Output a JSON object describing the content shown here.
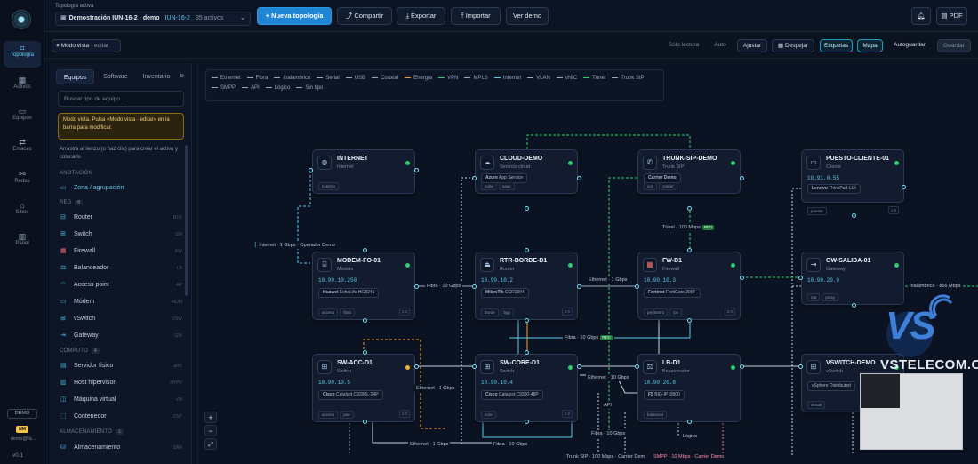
{
  "rail": {
    "items": [
      {
        "label": "Topología"
      },
      {
        "label": "Activos"
      },
      {
        "label": "Equipos"
      },
      {
        "label": "Enlaces"
      },
      {
        "label": "Redes"
      },
      {
        "label": "Sitios"
      },
      {
        "label": "Panel"
      }
    ],
    "badge": "DEMO",
    "avatar": "NM",
    "email": "demo@fa...",
    "version": "v0.1"
  },
  "topbar": {
    "breadcrumb": "Topología activa",
    "project": "Demostración IUN-16-2 · demo",
    "project_code": "IUN-16-2",
    "project_count": "35 activos",
    "btn_new": "+ Nueva topología",
    "btn_share": "Compartir",
    "btn_export": "Exportar",
    "btn_import": "Importar",
    "btn_demo": "Ver demo",
    "btn_pdf": "PDF"
  },
  "subbar": {
    "mode": "Modo vista",
    "mode_action": "· editar",
    "readonly": "Sólo lectura",
    "auto": "Auto",
    "fit": "Ajustar",
    "clear": "Despejar",
    "labels": "Etiquetas",
    "map": "Mapa",
    "autosave": "Autoguardar",
    "save": "Guardar"
  },
  "panel": {
    "tabs": [
      "Equipos",
      "Software",
      "Inventario",
      "Bi"
    ],
    "search_placeholder": "Buscar tipo de equipo...",
    "notice": "Modo vista. Pulsa «Modo vista · editar» en la barra para modificar.",
    "help": "Arrastra al lienzo (o haz clic) para crear el activo y colocarlo",
    "sec_annotation": "ANOTACIÓN",
    "zone": "Zona / agrupación",
    "sec_red": "RED",
    "red_count": "8",
    "red_items": [
      {
        "label": "Router",
        "sc": "RTR"
      },
      {
        "label": "Switch",
        "sc": "SW"
      },
      {
        "label": "Firewall",
        "sc": "FW"
      },
      {
        "label": "Balanceador",
        "sc": "LB"
      },
      {
        "label": "Access point",
        "sc": "AP"
      },
      {
        "label": "Módem",
        "sc": "MDM"
      },
      {
        "label": "vSwitch",
        "sc": "VSW"
      },
      {
        "label": "Gateway",
        "sc": "GW"
      }
    ],
    "sec_compute": "CÓMPUTO",
    "compute_count": "4",
    "compute_items": [
      {
        "label": "Servidor físico",
        "sc": "SRV"
      },
      {
        "label": "Host hipervisor",
        "sc": "HYPV"
      },
      {
        "label": "Máquina virtual",
        "sc": "VM"
      },
      {
        "label": "Contenedor",
        "sc": "CNT"
      }
    ],
    "sec_storage": "ALMACENAMIENTO",
    "storage_count": "1",
    "storage_items": [
      {
        "label": "Almacenamiento",
        "sc": "SAN"
      }
    ]
  },
  "legend": [
    {
      "label": "Ethernet",
      "color": "#9aa7b8"
    },
    {
      "label": "Fibra",
      "color": "#9aa7b8"
    },
    {
      "label": "Inalámbrico",
      "color": "#9aa7b8"
    },
    {
      "label": "Serial",
      "color": "#9aa7b8"
    },
    {
      "label": "USB",
      "color": "#9aa7b8"
    },
    {
      "label": "Coaxial",
      "color": "#9aa7b8"
    },
    {
      "label": "Energía",
      "color": "#f0a030"
    },
    {
      "label": "VPN",
      "color": "#2ecc71"
    },
    {
      "label": "MPLS",
      "color": "#9aa7b8"
    },
    {
      "label": "Internet",
      "color": "#5ec7e9"
    },
    {
      "label": "VLAN",
      "color": "#9aa7b8"
    },
    {
      "label": "vNIC",
      "color": "#9aa7b8"
    },
    {
      "label": "Túnel",
      "color": "#2ecc71"
    },
    {
      "label": "Trunk SIP",
      "color": "#9aa7b8"
    },
    {
      "label": "SMPP",
      "color": "#9aa7b8"
    },
    {
      "label": "API",
      "color": "#9aa7b8"
    },
    {
      "label": "Lógico",
      "color": "#9aa7b8"
    },
    {
      "label": "Sin tipo",
      "color": "#9aa7b8"
    }
  ],
  "nodes": {
    "internet": {
      "name": "INTERNET",
      "type": "Internet",
      "tags": [
        "externo"
      ],
      "dot": "#2ecc71",
      "icon": "globe-icon"
    },
    "cloud": {
      "name": "CLOUD-DEMO",
      "type": "Servicio cloud",
      "vendor": "Azure",
      "model": "App Service",
      "tags": [
        "nube",
        "saas"
      ],
      "dot": "#2ecc71",
      "icon": "cloud-icon"
    },
    "trunk": {
      "name": "TRUNK-SIP-DEMO",
      "type": "Trunk SIP",
      "vendor": "Carrier Demo",
      "model": "",
      "tags": [
        "voz",
        "carrier"
      ],
      "dot": "#2ecc71",
      "icon": "phone-icon"
    },
    "puesto": {
      "name": "PUESTO-CLIENTE-01",
      "type": "Cliente",
      "ip": "10.91.0.55",
      "vendor": "Lenovo",
      "model": "ThinkPad L14",
      "tags": [
        "puesto"
      ],
      "count": "1.0",
      "dot": "#2ecc71",
      "icon": "monitor-icon"
    },
    "modem": {
      "name": "MODEM-FO-01",
      "type": "Módem",
      "ip": "10.90.10.250",
      "vendor": "Huawei",
      "model": "EchoLife HG8245",
      "tags": [
        "acceso",
        "fibra"
      ],
      "count": "1.0",
      "dot": "#2ecc71",
      "icon": "modem-icon"
    },
    "rtr": {
      "name": "RTR-BORDE-D1",
      "type": "Router",
      "ip": "10.90.10.2",
      "vendor": "MikroTik",
      "model": "CCR2004",
      "tags": [
        "borde",
        "bgp"
      ],
      "count": "4.0",
      "dot": "#2ecc71",
      "icon": "router-icon"
    },
    "fw": {
      "name": "FW-D1",
      "type": "Firewall",
      "ip": "10.90.10.3",
      "vendor": "Fortinet",
      "model": "FortiGate 200F",
      "tags": [
        "perímetro",
        "ips"
      ],
      "count": "2.0",
      "dot": "#2ecc71",
      "icon": "firewall-icon"
    },
    "gw": {
      "name": "GW-SALIDA-01",
      "type": "Gateway",
      "ip": "10.90.20.9",
      "tags": [
        "nat",
        "proxy"
      ],
      "dot": "#2ecc71",
      "icon": "gateway-icon"
    },
    "swacc": {
      "name": "SW-ACC-D1",
      "type": "Switch",
      "ip": "10.90.10.5",
      "vendor": "Cisco",
      "model": "Catalyst C9200L-24P",
      "tags": [
        "acceso",
        "poe"
      ],
      "count": "1.0",
      "dot": "#f0b429",
      "icon": "switch-icon"
    },
    "swcore": {
      "name": "SW-CORE-D1",
      "type": "Switch",
      "ip": "10.90.10.4",
      "vendor": "Cisco",
      "model": "Catalyst C9300-48P",
      "tags": [
        "core"
      ],
      "count": "2.0",
      "dot": "#2ecc71",
      "icon": "switch-icon"
    },
    "lb": {
      "name": "LB-D1",
      "type": "Balanceador",
      "ip": "10.90.20.8",
      "vendor": "F5",
      "model": "BIG-IP i2800",
      "tags": [
        "balanceo"
      ],
      "dot": "#2ecc71",
      "icon": "balancer-icon"
    },
    "vswitch": {
      "name": "VSWITCH-DEMO",
      "type": "vSwitch",
      "vendor": "vSphere Distributed",
      "model": "",
      "tags": [
        "virtual"
      ],
      "dot": "#2ecc71",
      "icon": "vswitch-icon"
    }
  },
  "edge_labels": {
    "internet_modem": "Internet · 1 Gbps · Operador Demo",
    "tunnel": "Túnel · 100 Mbps",
    "red": "RED",
    "modem_rtr": "Fibra · 10 Gbps",
    "rtr_fw": "Ethernet · 1 Gbps",
    "fw_gw": "Inalámbrico · 866 Mbps",
    "core_fw": "Fibra · 10 Gbps",
    "core_lb": "Ethernet · 10 Gbps",
    "acc_core": "Ethernet · 1 Gbps",
    "api": "API",
    "bottom_eth": "Ethernet · 1 Gbps",
    "bottom_fibra": "Fibra · 10 Gbps",
    "fibra_low": "Fibra · 10 Gbps",
    "logico": "Lógico",
    "trunk_low": "Trunk SIP · 100 Mbps · Carrier Dem",
    "smpp": "SMPP · 10 Mbps · Carrier Demo"
  },
  "watermark": {
    "logo": "VS",
    "text": "VSTELECOM.CL"
  }
}
